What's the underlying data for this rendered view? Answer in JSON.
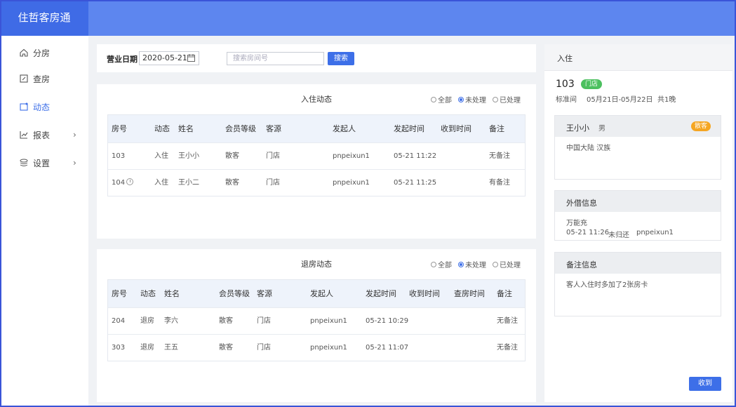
{
  "app": {
    "title": "住哲客房通"
  },
  "sidebar": {
    "items": [
      {
        "label": "分房",
        "icon": "home-icon"
      },
      {
        "label": "查房",
        "icon": "edit-icon"
      },
      {
        "label": "动态",
        "icon": "bell-icon",
        "active": true
      },
      {
        "label": "报表",
        "icon": "chart-icon",
        "has_children": true
      },
      {
        "label": "设置",
        "icon": "layers-icon",
        "has_children": true
      }
    ]
  },
  "filter": {
    "date_label": "营业日期",
    "date_value": "2020-05-21",
    "search_placeholder": "搜索房间号",
    "search_button": "搜索"
  },
  "checkin": {
    "title": "入住动态",
    "filters": [
      "全部",
      "未处理",
      "已处理"
    ],
    "selected_filter": "未处理",
    "columns": [
      "房号",
      "动态",
      "姓名",
      "会员等级",
      "客源",
      "发起人",
      "发起时间",
      "收到时间",
      "备注"
    ],
    "rows": [
      {
        "room": "103",
        "action": "入住",
        "name": "王小小",
        "level": "散客",
        "source": "门店",
        "initiator": "pnpeixun1",
        "time": "05-21 11:22",
        "received": "",
        "note": "无备注",
        "clock": false
      },
      {
        "room": "104",
        "action": "入住",
        "name": "王小二",
        "level": "散客",
        "source": "门店",
        "initiator": "pnpeixun1",
        "time": "05-21 11:25",
        "received": "",
        "note": "有备注",
        "clock": true
      }
    ]
  },
  "checkout": {
    "title": "退房动态",
    "filters": [
      "全部",
      "未处理",
      "已处理"
    ],
    "selected_filter": "未处理",
    "columns": [
      "房号",
      "动态",
      "姓名",
      "会员等级",
      "客源",
      "发起人",
      "发起时间",
      "收到时间",
      "查房时间",
      "备注"
    ],
    "rows": [
      {
        "room": "204",
        "action": "退房",
        "name": "李六",
        "level": "散客",
        "source": "门店",
        "initiator": "pnpeixun1",
        "time": "05-21 10:29",
        "received": "",
        "inspected": "",
        "note": "无备注"
      },
      {
        "room": "303",
        "action": "退房",
        "name": "王五",
        "level": "散客",
        "source": "门店",
        "initiator": "pnpeixun1",
        "time": "05-21 11:07",
        "received": "",
        "inspected": "",
        "note": "无备注"
      }
    ]
  },
  "detail": {
    "header": "入住",
    "room": "103",
    "room_tag": "门店",
    "room_type": "标准间",
    "date_range": "05月21日-05月22日",
    "nights": "共1晚",
    "guest": {
      "name": "王小小",
      "gender": "男",
      "tag": "散客",
      "origin": "中国大陆 汉族"
    },
    "borrow": {
      "title": "外借信息",
      "item": "万能充",
      "time": "05-21 11:26",
      "status": "未归还",
      "user": "pnpeixun1"
    },
    "remark": {
      "title": "备注信息",
      "text": "客人入住时多加了2张房卡"
    },
    "receive_button": "收到"
  },
  "colors": {
    "header": "#5d86ef",
    "brand": "#3f6be6",
    "primary": "#3d6fe8",
    "green_tag": "#4cc05f",
    "orange_tag": "#f5a623"
  }
}
